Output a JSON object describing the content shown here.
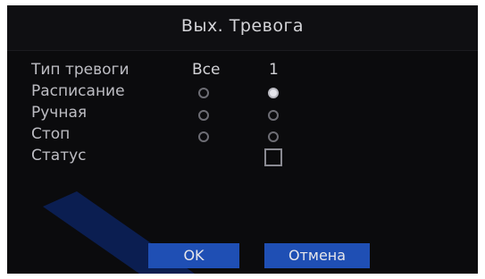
{
  "dialog": {
    "title": "Вых. Тревога"
  },
  "columns": {
    "all": "Все",
    "one": "1"
  },
  "rows": [
    {
      "label": "Тип тревоги"
    },
    {
      "label": "Расписание",
      "all_selected": false,
      "one_selected": true
    },
    {
      "label": "Ручная",
      "all_selected": false,
      "one_selected": false
    },
    {
      "label": "Стоп",
      "all_selected": false,
      "one_selected": false
    },
    {
      "label": "Статус",
      "status_checked": false
    }
  ],
  "buttons": {
    "ok": "OK",
    "cancel": "Отмена"
  },
  "colors": {
    "background": "#0b0b0d",
    "button": "#1f4fb4",
    "text": "#bdbdc3"
  }
}
